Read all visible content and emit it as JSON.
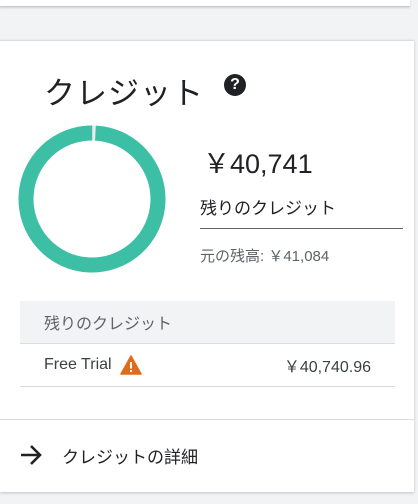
{
  "card": {
    "title": "クレジット",
    "help_icon": "question-circle-icon",
    "amount": "￥40,741",
    "remaining_label": "残りのクレジット",
    "original": "元の残高: ￥41,084",
    "donut": {
      "remaining_fraction": 0.9917,
      "color": "#3dbfa5"
    }
  },
  "table": {
    "header": "残りのクレジット",
    "rows": [
      {
        "name": "Free Trial",
        "icon": "warning-icon",
        "value": "￥40,740.96"
      }
    ]
  },
  "footer": {
    "icon": "arrow-right-icon",
    "link_label": "クレジットの詳細"
  }
}
